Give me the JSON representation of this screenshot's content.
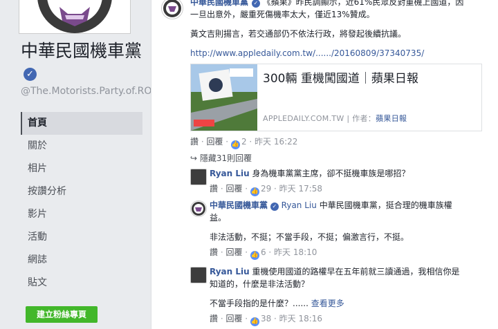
{
  "sidebar": {
    "page_name": "中華民國機車黨",
    "handle": "@The.Motorists.Party.of.ROC",
    "nav": [
      "首頁",
      "關於",
      "相片",
      "按讚分析",
      "影片",
      "活動",
      "網誌",
      "貼文"
    ],
    "create_button": "建立粉絲專頁"
  },
  "post": {
    "author": "中華民國機車黨",
    "line1": "《蘋果》昨民調顯示，近61%民眾反對重機上國道，因",
    "line2": "一旦出意外，嚴重死傷機率太大，僅近13%贊成。",
    "line3": "黃文吉則揚言，若交通部仍不依法行政，將發起後續抗議。",
    "url": "http://www.appledaily.com.tw/....../20160809/37340735/",
    "preview": {
      "title": "300輛 重機闖國道｜蘋果日報",
      "domain": "APPLEDAILY.COM.TW",
      "author_label": "作者：",
      "author": "蘋果日報"
    },
    "actions": {
      "like": "讚",
      "reply": "回覆",
      "count": "2",
      "time": "昨天 16:22"
    }
  },
  "hidden_replies": "隱藏31則回覆",
  "comments": [
    {
      "author": "Ryan Liu",
      "text1": "身為機車黨黨主席，卻不挺機車族是哪招？",
      "text2": "",
      "like": "讚",
      "reply": "回覆",
      "count": "29",
      "time": "昨天 17:58"
    },
    {
      "author": "中華民國機車黨",
      "mention": "Ryan Liu",
      "text1": "中華民國機車黨，挺合理的機車族權",
      "text2": "益。",
      "text3": "非法活動，不挺；不當手段，不挺；偏激言行，不挺。",
      "like": "讚",
      "reply": "回覆",
      "count": "6",
      "time": "昨天 18:10"
    },
    {
      "author": "Ryan Liu",
      "text1": "重機使用國道的路權早在五年前就三讀通過，我相信你是",
      "text2": "知道的，什麼是非法活動？",
      "text3": "不當手段指的是什麼？......",
      "more": "查看更多",
      "like": "讚",
      "reply": "回覆",
      "count": "38",
      "time": "昨天 18:16"
    }
  ]
}
